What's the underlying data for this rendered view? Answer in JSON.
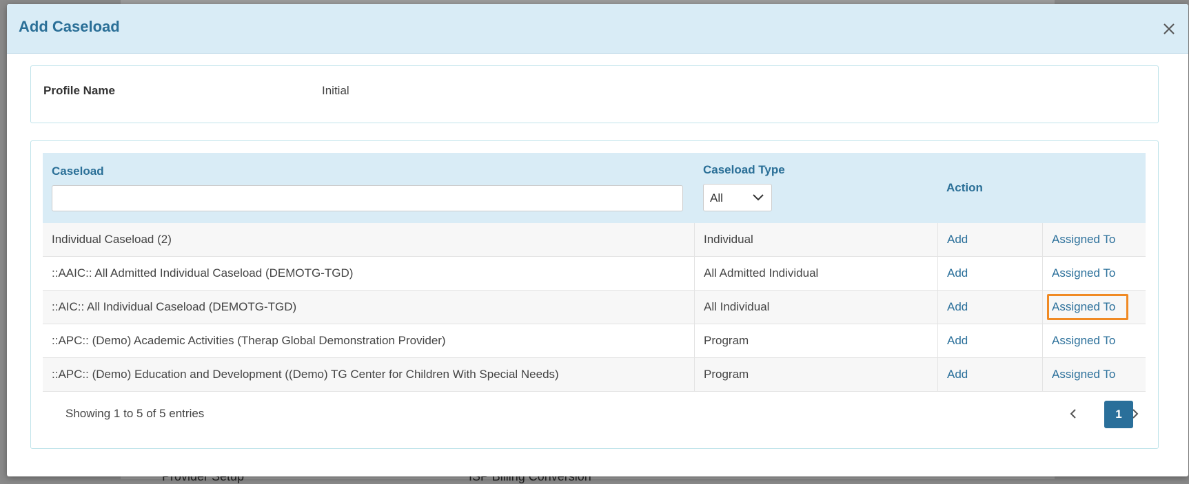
{
  "background": {
    "fragments": [
      "Provider Setup",
      "ISP Billing Conversion"
    ]
  },
  "modal": {
    "title": "Add Caseload",
    "close_icon": "close-icon"
  },
  "profile": {
    "label": "Profile Name",
    "value": "Initial"
  },
  "table": {
    "columns": {
      "caseload": "Caseload",
      "caseload_type": "Caseload Type",
      "action": "Action"
    },
    "filter": {
      "search_value": "",
      "type_selected": "All"
    },
    "rows": [
      {
        "caseload": "Individual Caseload (2)",
        "type": "Individual",
        "action": "Add",
        "assigned": "Assigned To"
      },
      {
        "caseload": "::AAIC:: All Admitted Individual Caseload (DEMOTG-TGD)",
        "type": "All Admitted Individual",
        "action": "Add",
        "assigned": "Assigned To"
      },
      {
        "caseload": "::AIC:: All Individual Caseload (DEMOTG-TGD)",
        "type": "All Individual",
        "action": "Add",
        "assigned": "Assigned To"
      },
      {
        "caseload": "::APC:: (Demo) Academic Activities (Therap Global Demonstration Provider)",
        "type": "Program",
        "action": "Add",
        "assigned": "Assigned To"
      },
      {
        "caseload": "::APC:: (Demo) Education and Development ((Demo) TG Center for Children With Special Needs)",
        "type": "Program",
        "action": "Add",
        "assigned": "Assigned To"
      }
    ],
    "footer": {
      "info": "Showing 1 to 5 of 5 entries",
      "current_page": "1"
    }
  },
  "colors": {
    "header_bg": "#d9ecf6",
    "title": "#2a6f97",
    "link": "#2a6f9a",
    "highlight": "#f08a24",
    "page_active": "#2a6f9a"
  }
}
